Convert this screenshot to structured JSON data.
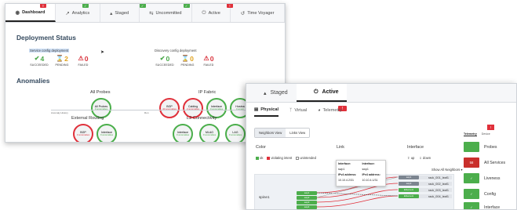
{
  "back_window": {
    "tabs": [
      {
        "label": "Dashboard",
        "icon": "dashboard-icon",
        "badge": "!",
        "badge_color": "red",
        "active": true
      },
      {
        "label": "Analytics",
        "icon": "chart-icon",
        "badge": "✓",
        "badge_color": "green"
      },
      {
        "label": "Staged",
        "icon": "flask-icon",
        "badge": "✓",
        "badge_color": "green"
      },
      {
        "label": "Uncommitted",
        "icon": "swap-icon",
        "badge": "✓",
        "badge_color": "green"
      },
      {
        "label": "Active",
        "icon": "power-icon",
        "badge": "!",
        "badge_color": "red"
      },
      {
        "label": "Time Voyager",
        "icon": "history-icon"
      }
    ],
    "deployment_status": {
      "title": "Deployment Status",
      "service": {
        "label": "Service config deployment",
        "succeeded": "4",
        "pending": "2",
        "failed": "0"
      },
      "discovery": {
        "label": "Discovery config deployment",
        "succeeded": "0",
        "pending": "0",
        "failed": "0"
      },
      "labels": {
        "succeeded": "SUCCEEDED",
        "pending": "PENDING",
        "failed": "FAILED"
      }
    },
    "anomalies": {
      "title": "Anomalies",
      "all_probes": {
        "title": "All Probes",
        "gauge": {
          "name": "All Probes",
          "sub": "0 anomalies"
        }
      },
      "ip_fabric": {
        "title": "IP Fabric",
        "gauges": [
          {
            "name": "BGP",
            "sub": "40 anomalies",
            "status": "red"
          },
          {
            "name": "Cabling",
            "sub": "2 anomalies",
            "status": "red"
          },
          {
            "name": "Interface",
            "sub": "0 anomalies",
            "status": "green"
          },
          {
            "name": "Hostna",
            "sub": "0 anom",
            "status": "green"
          }
        ]
      },
      "small_left": "Anomaly History",
      "small_right": "Run",
      "external_routing": {
        "title": "External Routing",
        "gauges": [
          {
            "name": "BGP",
            "sub": "3 anomalies",
            "status": "red"
          },
          {
            "name": "Interface",
            "sub": "0 anomalies",
            "status": "green"
          }
        ]
      },
      "l2_connectivity": {
        "title": "L2 Connectivity",
        "gauges": [
          {
            "name": "Interface",
            "sub": "0 anomalies",
            "status": "green"
          },
          {
            "name": "MLAG",
            "sub": "0 anomalies",
            "status": "green"
          },
          {
            "name": "LAG",
            "sub": "0 anomalies",
            "status": "green"
          }
        ]
      }
    }
  },
  "front_window": {
    "tabs": [
      {
        "label": "Staged",
        "icon": "flask-icon"
      },
      {
        "label": "Active",
        "icon": "power-icon",
        "active": true
      }
    ],
    "subtabs": [
      {
        "label": "Physical",
        "icon": "server-icon",
        "active": true
      },
      {
        "label": "Virtual",
        "icon": "branch-icon"
      },
      {
        "label": "Telemetry",
        "icon": "gauge-icon",
        "badge": "!"
      }
    ],
    "view_toggle": {
      "neighbors": "Neighbors View",
      "links": "Links View"
    },
    "columns": {
      "color": "Color",
      "link": "Link",
      "interface": "Interface"
    },
    "legend": {
      "ok": "ok",
      "violating": "violating intent",
      "unintended": "unintended"
    },
    "iface_legend": {
      "up": "up",
      "down": "down"
    },
    "show_all": "Show All Neighbors ▾",
    "spine": "spine1",
    "spine_ports": [
      "swp1",
      "swp2",
      "swp3",
      "swp4"
    ],
    "racks": [
      {
        "port": "swp1",
        "name": "rack_001_leaf1",
        "port_color": "grey"
      },
      {
        "port": "swp2",
        "name": "rack_002_leaf1",
        "port_color": "grey"
      },
      {
        "port": "Ethernet1",
        "name": "rack_003_leaf1",
        "port_color": "green"
      },
      {
        "port": "Ethernet1",
        "name": "rack_004_leaf1",
        "port_color": "green"
      }
    ],
    "tooltip": {
      "interface_a_label": "Interface:",
      "interface_a": "swp1",
      "interface_b_label": "Interface:",
      "interface_b": "swp1",
      "ipv4_a_label": "IPv4 address:",
      "ipv4_a": "10.10.4.2/31",
      "ipv4_b_label": "IPv4 address:",
      "ipv4_b": "10.10.4.1/31"
    },
    "right_panel": {
      "tabs": [
        "Telemetry",
        "Device"
      ],
      "badge": "!",
      "services": [
        {
          "label": "Probes",
          "status": "green",
          "value": ""
        },
        {
          "label": "All Services",
          "status": "red",
          "value": "58"
        },
        {
          "label": "Liveness",
          "status": "green",
          "value": "✓"
        },
        {
          "label": "Config",
          "status": "green",
          "value": "✓"
        },
        {
          "label": "Interface",
          "status": "green",
          "value": "✓"
        }
      ]
    }
  },
  "colors": {
    "green": "#4cae4c",
    "red": "#e0303a",
    "amber": "#e1a31f",
    "grey": "#7c8590"
  }
}
